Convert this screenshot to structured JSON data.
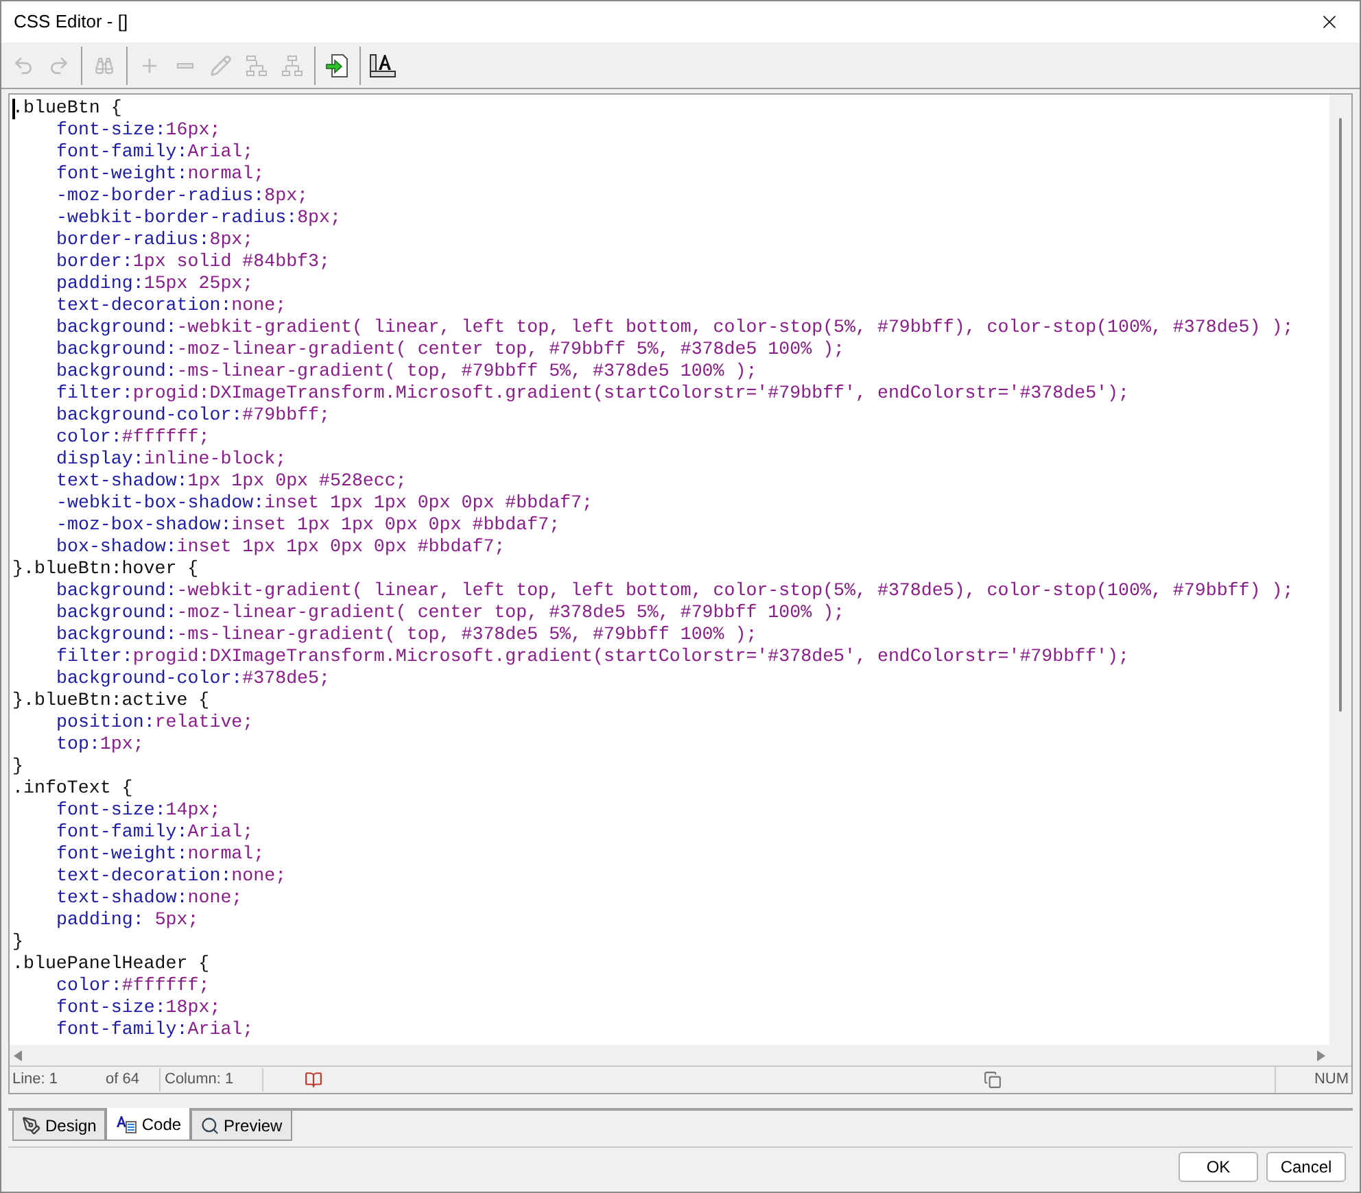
{
  "window": {
    "title": "CSS Editor - []"
  },
  "toolbar": [
    {
      "kind": "undo",
      "disabled": true
    },
    {
      "kind": "redo",
      "disabled": true
    },
    {
      "kind": "sep"
    },
    {
      "kind": "find",
      "disabled": true
    },
    {
      "kind": "sep"
    },
    {
      "kind": "add",
      "disabled": true
    },
    {
      "kind": "remove",
      "disabled": true
    },
    {
      "kind": "edit",
      "disabled": true
    },
    {
      "kind": "tree-down",
      "disabled": true
    },
    {
      "kind": "tree-up",
      "disabled": true
    },
    {
      "kind": "sep"
    },
    {
      "kind": "insert",
      "disabled": false
    },
    {
      "kind": "sep"
    },
    {
      "kind": "style",
      "disabled": false
    }
  ],
  "code_lines": [
    {
      "kind": "selector",
      "text": ".blueBtn {"
    },
    {
      "kind": "property",
      "property": "font-size:",
      "value": "16px;"
    },
    {
      "kind": "property",
      "property": "font-family:",
      "value": "Arial;"
    },
    {
      "kind": "property",
      "property": "font-weight:",
      "value": "normal;"
    },
    {
      "kind": "property",
      "property": "-moz-border-radius:",
      "value": "8px;"
    },
    {
      "kind": "property",
      "property": "-webkit-border-radius:",
      "value": "8px;"
    },
    {
      "kind": "property",
      "property": "border-radius:",
      "value": "8px;"
    },
    {
      "kind": "property",
      "property": "border:",
      "value": "1px solid #84bbf3;"
    },
    {
      "kind": "property",
      "property": "padding:",
      "value": "15px 25px;"
    },
    {
      "kind": "property",
      "property": "text-decoration:",
      "value": "none;"
    },
    {
      "kind": "property",
      "property": "background:",
      "value": "-webkit-gradient( linear, left top, left bottom, color-stop(5%, #79bbff), color-stop(100%, #378de5) );"
    },
    {
      "kind": "property",
      "property": "background:",
      "value": "-moz-linear-gradient( center top, #79bbff 5%, #378de5 100% );"
    },
    {
      "kind": "property",
      "property": "background:",
      "value": "-ms-linear-gradient( top, #79bbff 5%, #378de5 100% );"
    },
    {
      "kind": "property",
      "property": "filter:",
      "value": "progid:DXImageTransform.Microsoft.gradient(startColorstr='#79bbff', endColorstr='#378de5');"
    },
    {
      "kind": "property",
      "property": "background-color:",
      "value": "#79bbff;"
    },
    {
      "kind": "property",
      "property": "color:",
      "value": "#ffffff;"
    },
    {
      "kind": "property",
      "property": "display:",
      "value": "inline-block;"
    },
    {
      "kind": "property",
      "property": "text-shadow:",
      "value": "1px 1px 0px #528ecc;"
    },
    {
      "kind": "property",
      "property": "-webkit-box-shadow:",
      "value": "inset 1px 1px 0px 0px #bbdaf7;"
    },
    {
      "kind": "property",
      "property": "-moz-box-shadow:",
      "value": "inset 1px 1px 0px 0px #bbdaf7;"
    },
    {
      "kind": "property",
      "property": "box-shadow:",
      "value": "inset 1px 1px 0px 0px #bbdaf7;"
    },
    {
      "kind": "selector",
      "text": "}.blueBtn:hover {"
    },
    {
      "kind": "property",
      "property": "background:",
      "value": "-webkit-gradient( linear, left top, left bottom, color-stop(5%, #378de5), color-stop(100%, #79bbff) );"
    },
    {
      "kind": "property",
      "property": "background:",
      "value": "-moz-linear-gradient( center top, #378de5 5%, #79bbff 100% );"
    },
    {
      "kind": "property",
      "property": "background:",
      "value": "-ms-linear-gradient( top, #378de5 5%, #79bbff 100% );"
    },
    {
      "kind": "property",
      "property": "filter:",
      "value": "progid:DXImageTransform.Microsoft.gradient(startColorstr='#378de5', endColorstr='#79bbff');"
    },
    {
      "kind": "property",
      "property": "background-color:",
      "value": "#378de5;"
    },
    {
      "kind": "selector",
      "text": "}.blueBtn:active {"
    },
    {
      "kind": "property",
      "property": "position:",
      "value": "relative;"
    },
    {
      "kind": "property",
      "property": "top:",
      "value": "1px;"
    },
    {
      "kind": "selector",
      "text": "}"
    },
    {
      "kind": "selector",
      "text": ".infoText {"
    },
    {
      "kind": "property",
      "property": "font-size:",
      "value": "14px;"
    },
    {
      "kind": "property",
      "property": "font-family:",
      "value": "Arial;"
    },
    {
      "kind": "property",
      "property": "font-weight:",
      "value": "normal;"
    },
    {
      "kind": "property",
      "property": "text-decoration:",
      "value": "none;"
    },
    {
      "kind": "property",
      "property": "text-shadow:",
      "value": "none;"
    },
    {
      "kind": "property",
      "property": "padding:",
      "value": " 5px;"
    },
    {
      "kind": "selector",
      "text": "}"
    },
    {
      "kind": "selector",
      "text": ".bluePanelHeader {"
    },
    {
      "kind": "property",
      "property": "color:",
      "value": "#ffffff;"
    },
    {
      "kind": "property",
      "property": "font-size:",
      "value": "18px;"
    },
    {
      "kind": "property",
      "property": "font-family:",
      "value": "Arial;"
    }
  ],
  "status_bar": {
    "line": "Line: 1",
    "of": "of 64",
    "column": "Column: 1",
    "mode": "NUM"
  },
  "tabs": [
    {
      "label": "Design",
      "kind": "design",
      "selected": false
    },
    {
      "label": "Code",
      "kind": "code",
      "selected": true
    },
    {
      "label": "Preview",
      "kind": "preview",
      "selected": false
    }
  ],
  "buttons": [
    "OK",
    "Cancel"
  ]
}
